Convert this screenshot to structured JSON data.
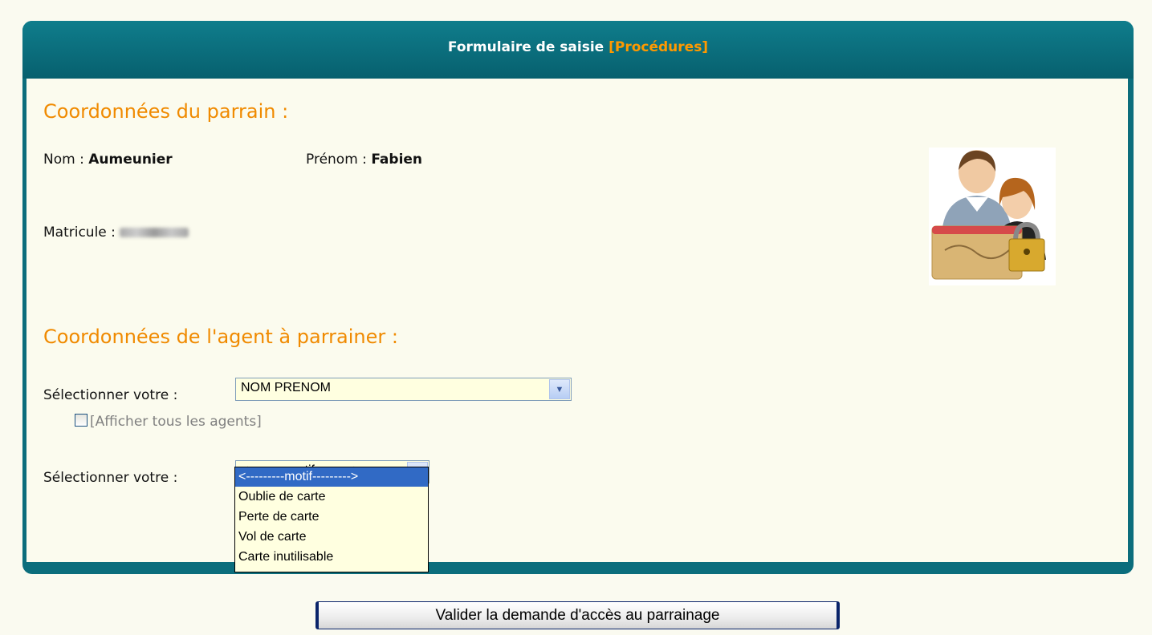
{
  "header": {
    "title": "Formulaire de saisie",
    "link": "[Procédures]"
  },
  "parrain": {
    "section_title": "Coordonnées du parrain :",
    "nom_label": "Nom :",
    "nom_value": "Aumeunier",
    "prenom_label": "Prénom :",
    "prenom_value": "Fabien",
    "matricule_label": "Matricule :"
  },
  "agent": {
    "section_title": "Coordonnées de l'agent à parrainer :",
    "select1_label": "Sélectionner votre :",
    "select1_value": "NOM PRENOM",
    "checkbox_label": "[Afficher tous les agents]",
    "select2_label": "Sélectionner votre :",
    "select2_value": "<---------motif--------->",
    "select2_options": [
      "<---------motif--------->",
      "Oublie de carte",
      "Perte de carte",
      "Vol de carte",
      "Carte inutilisable"
    ]
  },
  "submit_label": "Valider la demande d'accès au parrainage",
  "colors": {
    "panel": "#0b6d7c",
    "accent": "#f08a00",
    "link": "#ff9900",
    "selection": "#316ac5"
  },
  "icons": {
    "avatar": "users-card-lock-icon",
    "dropdown": "chevron-down-icon"
  }
}
